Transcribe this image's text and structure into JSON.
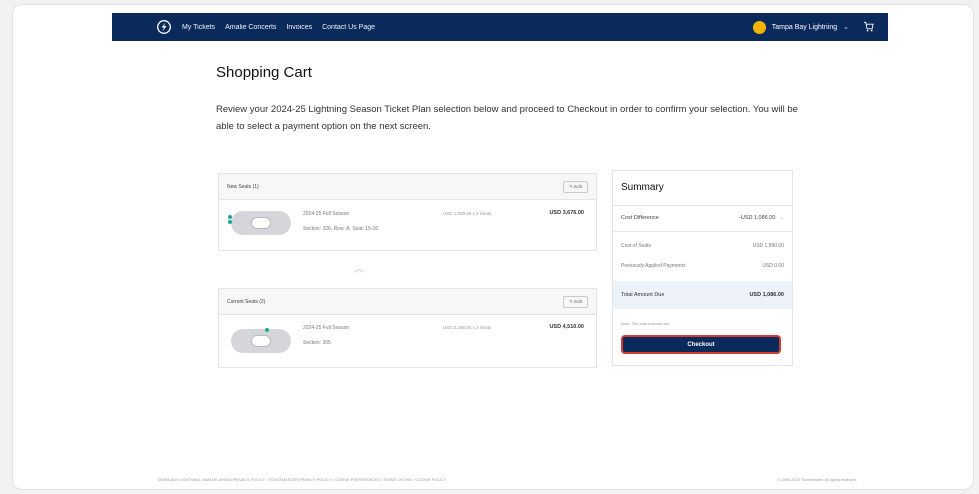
{
  "nav": {
    "links": [
      "My Tickets",
      "Amalie Concerts",
      "Invoices",
      "Contact Us Page"
    ],
    "account": "Tampa Bay Lightning",
    "account_chevron": "⌄",
    "cart_icon": "cart-icon",
    "logo_icon": "lightning-bolt-logo"
  },
  "page": {
    "title": "Shopping Cart",
    "intro": "Review your 2024-25 Lightning Season Ticket Plan selection below and proceed to Checkout in order to confirm your selection. You will be able to select a payment option on the next screen."
  },
  "new_seats": {
    "header": "New Seats (1)",
    "edit": "Edit",
    "line1": "2024-25 Full Season",
    "line2": "Section: 326, Row: A, Seat: 15-16",
    "price": "USD 1,838.00 x 2 Seats",
    "total": "USD 3,676.00"
  },
  "current_seats": {
    "header": "Current Seats (2)",
    "edit": "Edit",
    "line1": "2024-25 Full Season",
    "line2": "Section: 305",
    "price": "USD 2,256.00 x 2 Seats",
    "total": "USD 4,510.00"
  },
  "summary": {
    "title": "Summary",
    "cost_diff_label": "Cost Difference",
    "cost_diff_value": "-USD 1,086.00",
    "cost_of_seats_label": "Cost of Seats",
    "cost_of_seats_value": "USD 1,890.00",
    "prev_payments_label": "Previously Applied Payments",
    "prev_payments_value": "USD 0.00",
    "total_label": "Total Amount Due",
    "total_value": "USD 1,086.00",
    "note": "Note: The total includes fee",
    "checkout": "Checkout"
  },
  "footer": {
    "links": "TAMPA BAY LIGHTNING / AMALIE ARENA PRIVACY POLICY  /  TICKETMASTER PRIVACY POLICY  /  COOKIE PREFERENCES  /  TERMS OF USE  /  COOKIE POLICY",
    "copyright": "© 1999-2024 Ticketmaster. All rights reserved."
  },
  "colors": {
    "navy": "#0a2a5c",
    "accent": "#d43a2e",
    "gold": "#f5b500",
    "teal": "#1ca898"
  }
}
